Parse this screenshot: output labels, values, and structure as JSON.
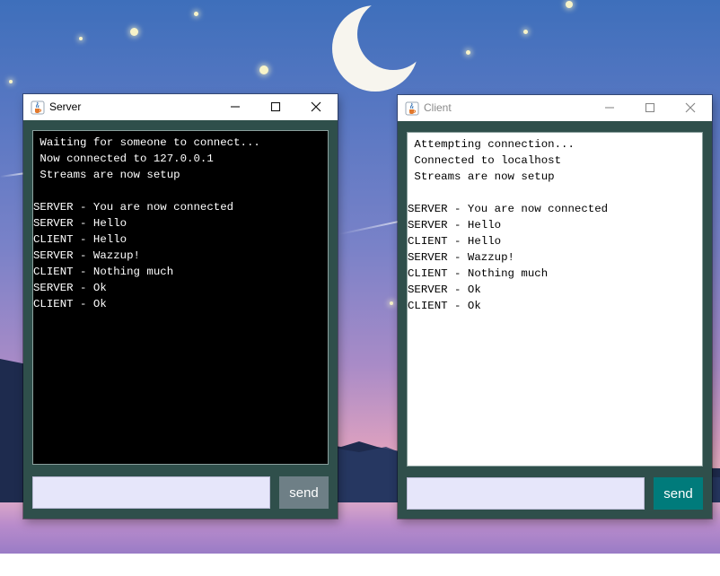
{
  "server_window": {
    "title": "Server",
    "title_icon": "java-cup-icon",
    "controls": [
      "minimize-icon",
      "maximize-icon",
      "close-icon"
    ],
    "log_lines": [
      " Waiting for someone to connect...",
      " Now connected to 127.0.0.1",
      " Streams are now setup",
      "",
      "SERVER - You are now connected",
      "SERVER - Hello",
      "CLIENT - Hello",
      "SERVER - Wazzup!",
      "CLIENT - Nothing much",
      "SERVER - Ok",
      "CLIENT - Ok"
    ],
    "input_value": "",
    "send_label": "send",
    "send_color": "#6e7f86",
    "log_background": "#000000",
    "log_text_color": "#ffffff"
  },
  "client_window": {
    "title": "Client",
    "title_icon": "java-cup-icon",
    "controls": [
      "minimize-icon",
      "maximize-icon",
      "close-icon"
    ],
    "log_lines": [
      " Attempting connection...",
      " Connected to localhost",
      " Streams are now setup",
      "",
      "SERVER - You are now connected",
      "SERVER - Hello",
      "CLIENT - Hello",
      "SERVER - Wazzup!",
      "CLIENT - Nothing much",
      "SERVER - Ok",
      "CLIENT - Ok"
    ],
    "input_value": "",
    "send_label": "send",
    "send_color": "#007b7b",
    "log_background": "#ffffff",
    "log_text_color": "#000000"
  },
  "colors": {
    "window_frame": "#2f4f4b",
    "input_background": "#e6e6fa"
  }
}
